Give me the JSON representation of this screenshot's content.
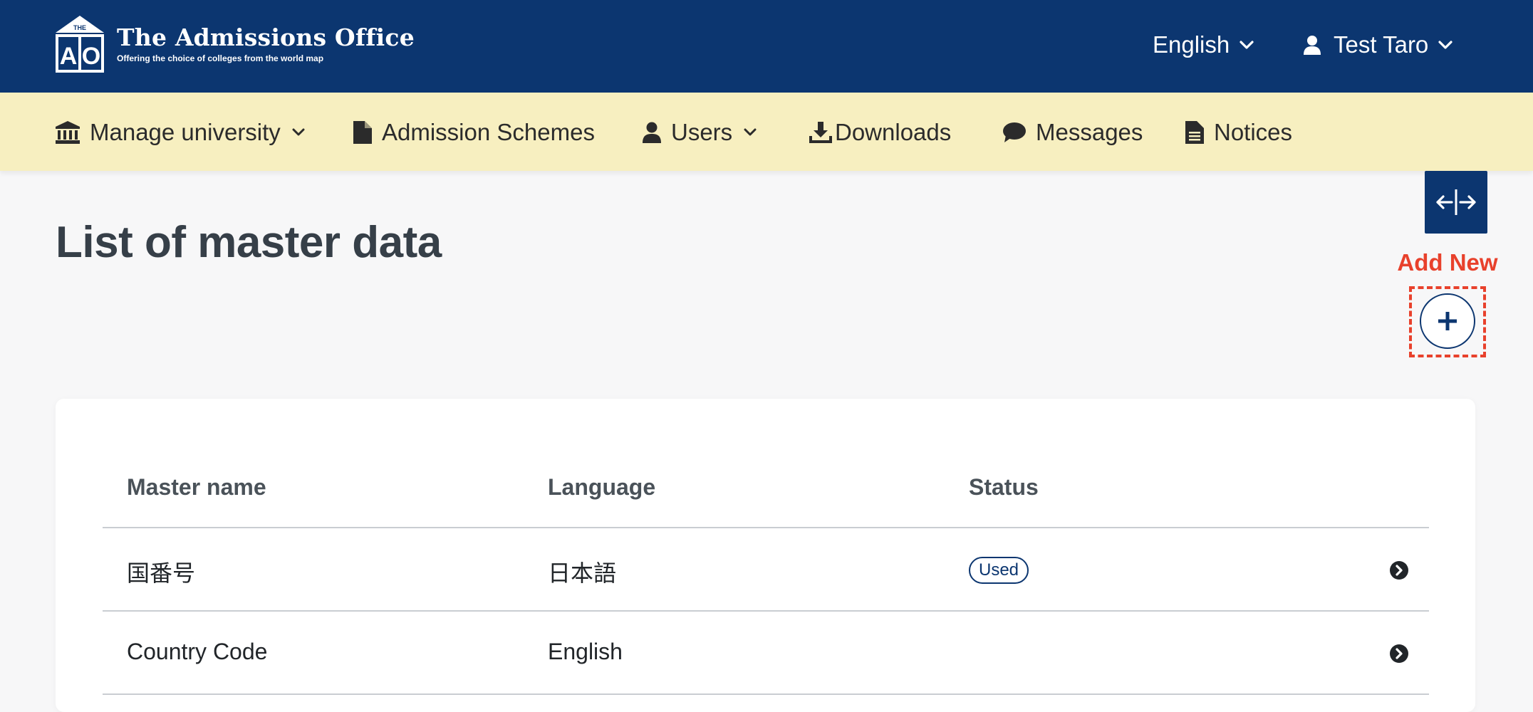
{
  "header": {
    "logo_mark_text": "THE AO",
    "logo_title": "The Admissions Office",
    "logo_tagline": "Offering the choice of colleges from the world map",
    "language": "English",
    "user_name": "Test Taro"
  },
  "nav": {
    "items": [
      {
        "label": "Manage university",
        "icon": "university-icon",
        "has_dropdown": true
      },
      {
        "label": "Admission Schemes",
        "icon": "file-icon",
        "has_dropdown": false
      },
      {
        "label": "Users",
        "icon": "user-icon",
        "has_dropdown": true
      },
      {
        "label": "Downloads",
        "icon": "download-icon",
        "has_dropdown": false
      },
      {
        "label": "Messages",
        "icon": "comment-icon",
        "has_dropdown": false
      },
      {
        "label": "Notices",
        "icon": "file-text-icon",
        "has_dropdown": false
      }
    ]
  },
  "main": {
    "title": "List of master data",
    "add_new_label": "Add New"
  },
  "table": {
    "columns": [
      "Master name",
      "Language",
      "Status"
    ],
    "rows": [
      {
        "name": "国番号",
        "language": "日本語",
        "status": "Used"
      },
      {
        "name": "Country Code",
        "language": "English",
        "status": ""
      }
    ]
  },
  "colors": {
    "primary": "#0c3670",
    "nav_bg": "#f7efc0",
    "annotation": "#e8412c",
    "page_bg": "#f7f7f8"
  }
}
